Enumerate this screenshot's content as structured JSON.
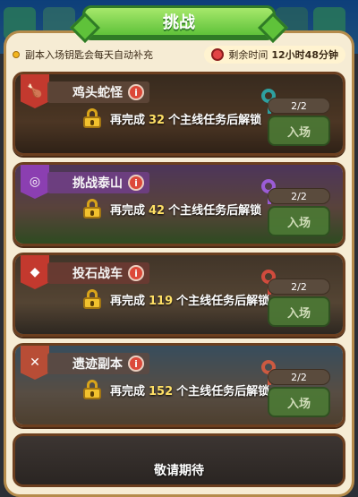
{
  "title": "挑战",
  "info": {
    "refill_note": "副本入场钥匙会每天自动补充",
    "timer_label": "剩余时间",
    "timer_value": "12小时48分钟"
  },
  "dungeons": [
    {
      "name": "鸡头蛇怪",
      "unlock_prefix": "再完成",
      "unlock_count": "32",
      "unlock_suffix": "个主线任务后解锁",
      "keys": "2/2",
      "enter_label": "入场",
      "key_color": "#2ea0a0",
      "icon": "drumstick-icon"
    },
    {
      "name": "挑战泰山",
      "unlock_prefix": "再完成",
      "unlock_count": "42",
      "unlock_suffix": "个主线任务后解锁",
      "keys": "2/2",
      "enter_label": "入场",
      "key_color": "#9b5cd6",
      "icon": "ring-icon"
    },
    {
      "name": "投石战车",
      "unlock_prefix": "再完成",
      "unlock_count": "119",
      "unlock_suffix": "个主线任务后解锁",
      "keys": "2/2",
      "enter_label": "入场",
      "key_color": "#d14b3d",
      "icon": "gem-icon"
    },
    {
      "name": "遗迹副本",
      "unlock_prefix": "再完成",
      "unlock_count": "152",
      "unlock_suffix": "个主线任务后解锁",
      "keys": "2/2",
      "enter_label": "入场",
      "key_color": "#cc5a41",
      "icon": "crossed-swords-icon"
    }
  ],
  "coming_soon": "敬请期待"
}
